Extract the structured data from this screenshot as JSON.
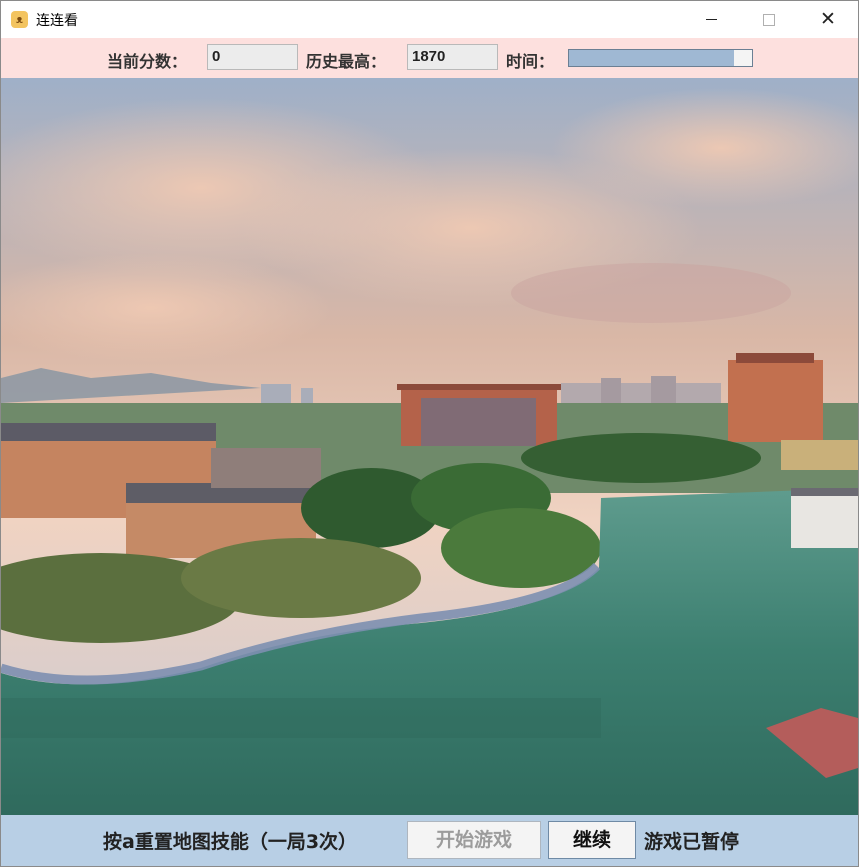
{
  "window": {
    "title": "连连看",
    "icon": "dog-face-icon",
    "controls": {
      "minimize": "minimize-icon",
      "maximize": "maximize-icon",
      "close": "close-icon"
    }
  },
  "scoreboard": {
    "current_score_label": "当前分数：",
    "current_score": "0",
    "high_score_label": "历史最高：",
    "high_score": "1870",
    "time_label": "时间：",
    "time_remaining_fraction": 0.9
  },
  "scene": {
    "description_icon": "campus-lake-photo"
  },
  "controls": {
    "reset_hint": "按a重置地图技能（一局3次）",
    "start_button": "开始游戏",
    "resume_button": "继续",
    "status": "游戏已暂停"
  },
  "colors": {
    "topbar_bg": "#fde0de",
    "bottombar_bg": "#b8cfe5",
    "timebar_fill": "#9fb8d3"
  }
}
